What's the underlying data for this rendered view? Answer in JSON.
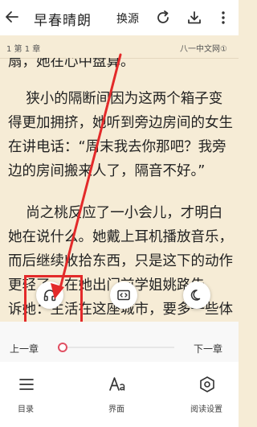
{
  "header": {
    "title": "早春晴朗",
    "switch_source": "换源"
  },
  "chapter_bar": {
    "chapter": "1 第 1 章",
    "site": "八一中文网①"
  },
  "content": {
    "lines_p0": [
      "扇，她在心中盘算。"
    ],
    "lines_p1": [
      "    狭小的隔断间因为这两个箱子变",
      "得更加拥挤，她听到旁边房间的女生",
      "在讲电话：“周末我去你那吧？我旁",
      "边的房间搬来人了，隔音不好。”"
    ],
    "lines_p2": [
      "    尚之桃反应了一小会儿，才明白",
      "她在说什么。她戴上耳机播放音乐，",
      "而后继续收拾东西，只是这下的动作",
      "更轻了。在她出门前学姐姚路告",
      "诉她：生活在这座城市，要多一些体"
    ]
  },
  "progress": {
    "prev": "上一章",
    "next": "下一章",
    "value": 0.04
  },
  "bottom_nav": {
    "items": [
      {
        "label": "目录",
        "icon": "list-icon"
      },
      {
        "label": "界面",
        "icon": "font-size-icon"
      },
      {
        "label": "阅读设置",
        "icon": "settings-hex-icon"
      }
    ]
  },
  "colors": {
    "page_bg": "#f6ecd6",
    "accent": "#e05063",
    "annotation": "#e32a2a"
  }
}
